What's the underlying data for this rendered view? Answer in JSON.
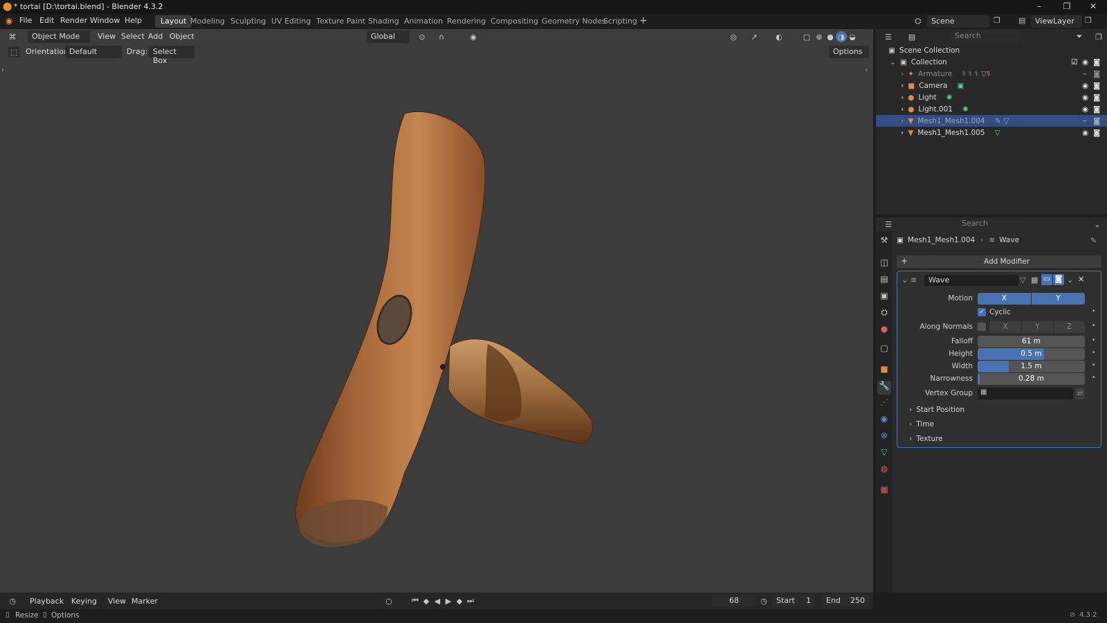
{
  "title": "* tortai [D:\\tortai.blend] - Blender 4.3.2",
  "menu": [
    "File",
    "Edit",
    "Render",
    "Window",
    "Help"
  ],
  "workspaces": [
    "Layout",
    "Modeling",
    "Sculpting",
    "UV Editing",
    "Texture Paint",
    "Shading",
    "Animation",
    "Rendering",
    "Compositing",
    "Geometry Nodes",
    "Scripting"
  ],
  "active_workspace": "Layout",
  "scene": "Scene",
  "viewlayer": "ViewLayer",
  "viewport": {
    "mode": "Object Mode",
    "menus": [
      "View",
      "Select",
      "Add",
      "Object"
    ],
    "transform": "Global",
    "orientation_label": "Orientation:",
    "orientation": "Default",
    "drag_label": "Drag:",
    "drag": "Select Box",
    "options": "Options"
  },
  "outliner": {
    "search": "Search",
    "root": "Scene Collection",
    "collection": "Collection",
    "items": [
      {
        "name": "Armature",
        "dim": true,
        "selected": false
      },
      {
        "name": "Camera",
        "dim": false,
        "selected": false
      },
      {
        "name": "Light",
        "dim": false,
        "selected": false
      },
      {
        "name": "Light.001",
        "dim": false,
        "selected": false
      },
      {
        "name": "Mesh1_Mesh1.004",
        "dim": true,
        "selected": true
      },
      {
        "name": "Mesh1_Mesh1.005",
        "dim": false,
        "selected": false
      }
    ],
    "armature_badge": "5"
  },
  "properties": {
    "search": "Search",
    "object": "Mesh1_Mesh1.004",
    "modifier": "Wave",
    "add_modifier": "Add Modifier",
    "mod_name": "Wave",
    "motion_label": "Motion",
    "motion_x": "X",
    "motion_y": "Y",
    "cyclic": "Cyclic",
    "along_normals": "Along Normals",
    "axes": [
      "X",
      "Y",
      "Z"
    ],
    "falloff_label": "Falloff",
    "falloff": "61 m",
    "height_label": "Height",
    "height": "0.5 m",
    "height_level": 0.62,
    "width_label": "Width",
    "width": "1.5 m",
    "width_level": 0.29,
    "narrowness_label": "Narrowness",
    "narrowness": "0.28 m",
    "narrowness_level": 0.02,
    "vertex_group": "Vertex Group",
    "sections": [
      "Start Position",
      "Time",
      "Texture"
    ]
  },
  "timeline": {
    "menus": [
      "Playback",
      "Keying",
      "View",
      "Marker"
    ],
    "frame": "68",
    "start_label": "Start",
    "start": "1",
    "end_label": "End",
    "end": "250"
  },
  "status": {
    "resize": "Resize",
    "options": "Options",
    "version": "4.3.2"
  },
  "colors": {
    "accent": "#4772b3",
    "selection": "#334d80",
    "viewport_bg": "#3c3c3c"
  }
}
